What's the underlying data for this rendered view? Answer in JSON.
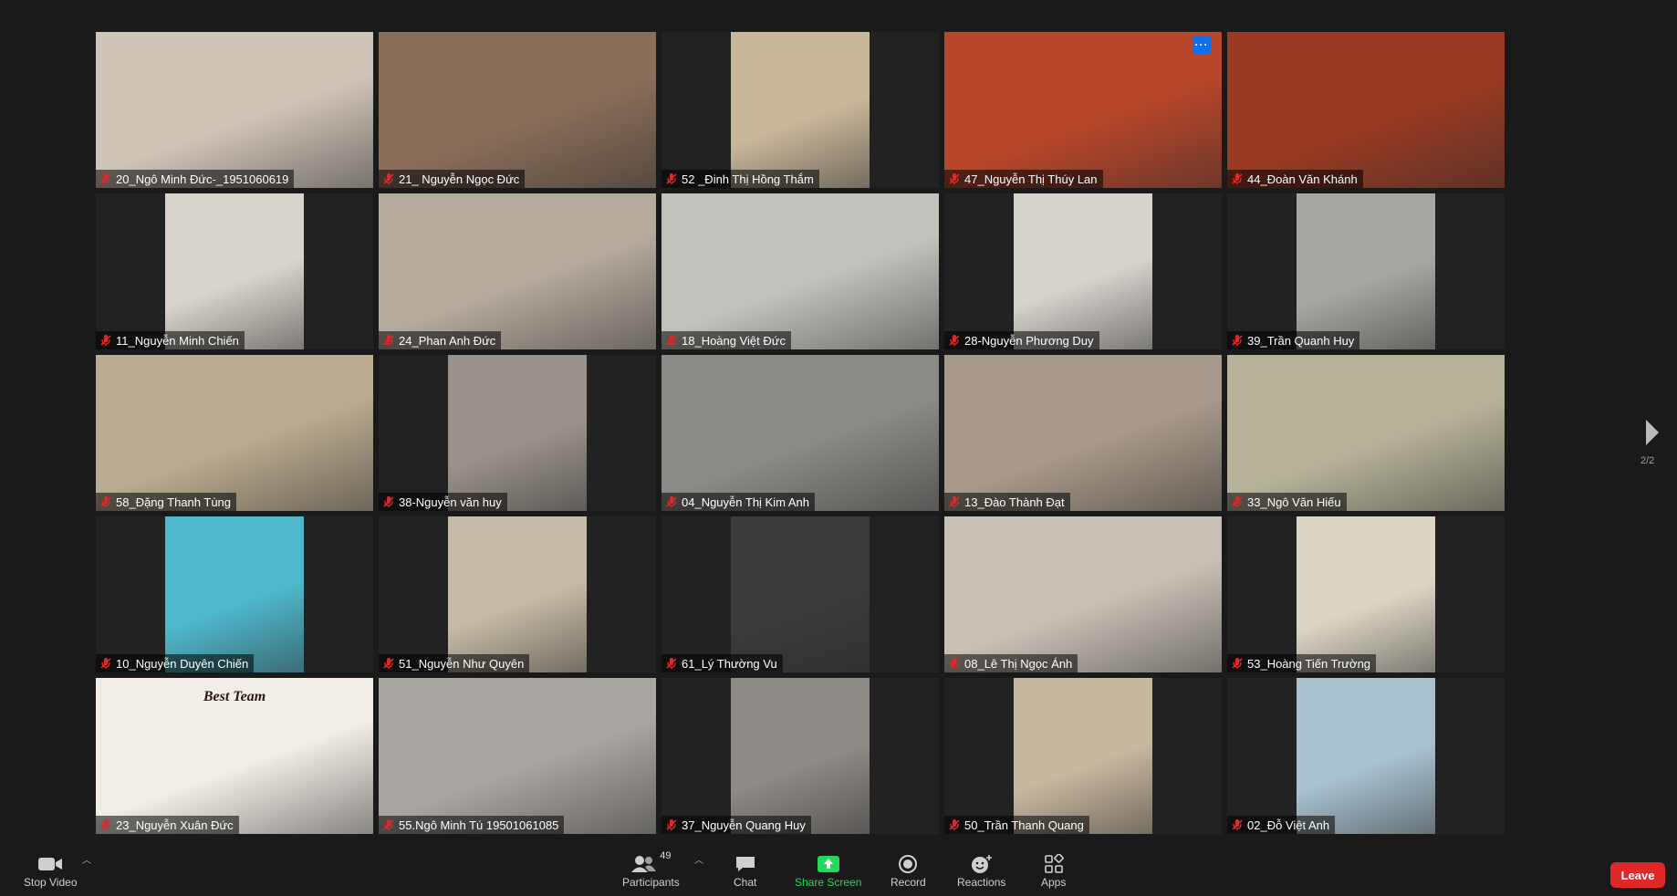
{
  "participants": [
    {
      "name": "20_Ngô Minh Đức-_1951060619",
      "bg": "#cfc4b8",
      "wide": true
    },
    {
      "name": "21_ Nguyễn Ngọc Đức",
      "bg": "#8a6e5a",
      "wide": true
    },
    {
      "name": "52 _Đinh Thị Hồng Thắm",
      "bg": "#c8b79a",
      "wide": false
    },
    {
      "name": "47_Nguyễn Thị Thúy Lan",
      "bg": "#b8462a",
      "wide": true,
      "more": true
    },
    {
      "name": "44_Đoàn Văn Khánh",
      "bg": "#9a3a22",
      "wide": true
    },
    {
      "name": "11_Nguyễn Minh Chiến",
      "bg": "#d9d4cc",
      "wide": false
    },
    {
      "name": "24_Phan Anh Đức",
      "bg": "#b4aa9e",
      "wide": true
    },
    {
      "name": "18_Hoàng Việt Đức",
      "bg": "#c2c2bc",
      "wide": true
    },
    {
      "name": "28-Nguyễn Phương Duy",
      "bg": "#d6d2cc",
      "wide": false
    },
    {
      "name": "39_Trần Quanh Huy",
      "bg": "#a8a6a2",
      "wide": false
    },
    {
      "name": "58_Đặng Thanh Tùng",
      "bg": "#b9ab8f",
      "wide": true
    },
    {
      "name": "38-Nguyễn văn huy",
      "bg": "#9a928a",
      "wide": false
    },
    {
      "name": "04_Nguyễn Thị Kim Anh",
      "bg": "#8c8a86",
      "wide": true
    },
    {
      "name": "13_Đào Thành Đạt",
      "bg": "#a89a8a",
      "wide": true
    },
    {
      "name": "33_Ngô Văn Hiếu",
      "bg": "#b6b29a",
      "wide": true
    },
    {
      "name": "10_Nguyễn Duyên Chiến",
      "bg": "#4fb8cc",
      "wide": false
    },
    {
      "name": "51_Nguyễn Như Quyên",
      "bg": "#c4baa6",
      "wide": false
    },
    {
      "name": "61_Lý Thường Vu",
      "bg": "#3a3a3a",
      "wide": false
    },
    {
      "name": "08_Lê Thị Ngọc Ánh",
      "bg": "#c8c0b6",
      "wide": true
    },
    {
      "name": "53_Hoàng Tiến Trường",
      "bg": "#ddd6c6",
      "wide": false
    },
    {
      "name": "23_Nguyễn Xuân Đức",
      "bg": "#f2ede6",
      "wide": true
    },
    {
      "name": "55.Ngô Minh Tú 19501061085",
      "bg": "#a9a5a0",
      "wide": true
    },
    {
      "name": "37_Nguyễn Quang Huy",
      "bg": "#8e8a86",
      "wide": false
    },
    {
      "name": "50_Trần Thanh Quang",
      "bg": "#c8b8a0",
      "wide": false
    },
    {
      "name": "02_Đỗ Việt Anh",
      "bg": "#a9c2d0",
      "wide": false
    }
  ],
  "overlay_text": {
    "best_team": "Best Team"
  },
  "pagination": {
    "indicator": "2/2"
  },
  "toolbar": {
    "stop_video": "Stop Video",
    "participants": "Participants",
    "participants_count": "49",
    "chat": "Chat",
    "share_screen": "Share Screen",
    "record": "Record",
    "reactions": "Reactions",
    "apps": "Apps",
    "leave": "Leave"
  },
  "colors": {
    "muted_mic": "#e02828",
    "share_green": "#23d959",
    "leave_red": "#e02828"
  }
}
